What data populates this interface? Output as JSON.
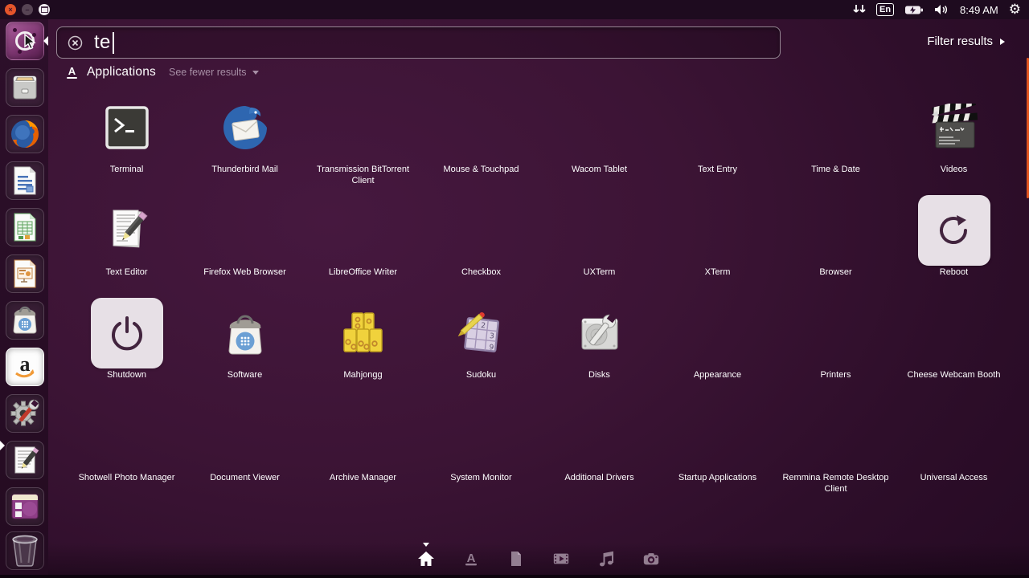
{
  "topbar": {
    "time": "8:49 AM",
    "keyboard_layout": "En",
    "window_controls": [
      "close",
      "minimize",
      "maximize"
    ],
    "tray_icons": [
      "network-transfer-arrows-icon",
      "keyboard-layout-indicator",
      "battery-charging-icon",
      "volume-icon",
      "clock",
      "session-gear-icon"
    ]
  },
  "search": {
    "query": "te",
    "clear_icon": "circle-x-icon",
    "filter_label": "Filter results"
  },
  "category_header": {
    "lens_icon": "applications-lens-icon",
    "label": "Applications",
    "toggle_label": "See fewer results"
  },
  "apps": [
    {
      "label": "Terminal",
      "icon": "terminal-icon"
    },
    {
      "label": "Thunderbird Mail",
      "icon": "thunderbird-icon"
    },
    {
      "label": "Transmission BitTorrent Client",
      "icon": null
    },
    {
      "label": "Mouse & Touchpad",
      "icon": null
    },
    {
      "label": "Wacom Tablet",
      "icon": null
    },
    {
      "label": "Text Entry",
      "icon": null
    },
    {
      "label": "Time & Date",
      "icon": null
    },
    {
      "label": "Videos",
      "icon": "clapperboard-icon"
    },
    {
      "label": "Text Editor",
      "icon": "text-editor-icon"
    },
    {
      "label": "Firefox Web Browser",
      "icon": null
    },
    {
      "label": "LibreOffice Writer",
      "icon": null
    },
    {
      "label": "Checkbox",
      "icon": null
    },
    {
      "label": "UXTerm",
      "icon": null
    },
    {
      "label": "XTerm",
      "icon": null
    },
    {
      "label": "Browser",
      "icon": null
    },
    {
      "label": "Reboot",
      "icon": "reboot-arrow-icon",
      "highlighted": true
    },
    {
      "label": "Shutdown",
      "icon": "power-icon",
      "highlighted": true
    },
    {
      "label": "Software",
      "icon": "software-bag-icon"
    },
    {
      "label": "Mahjongg",
      "icon": "mahjongg-tiles-icon"
    },
    {
      "label": "Sudoku",
      "icon": "sudoku-grid-icon"
    },
    {
      "label": "Disks",
      "icon": "disk-wrench-icon"
    },
    {
      "label": "Appearance",
      "icon": null
    },
    {
      "label": "Printers",
      "icon": null
    },
    {
      "label": "Cheese Webcam Booth",
      "icon": null
    },
    {
      "label": "Shotwell Photo Manager",
      "icon": null
    },
    {
      "label": "Document Viewer",
      "icon": null
    },
    {
      "label": "Archive Manager",
      "icon": null
    },
    {
      "label": "System Monitor",
      "icon": null
    },
    {
      "label": "Additional Drivers",
      "icon": null
    },
    {
      "label": "Startup Applications",
      "icon": null
    },
    {
      "label": "Remmina Remote Desktop Client",
      "icon": null
    },
    {
      "label": "Universal Access",
      "icon": null
    }
  ],
  "launcher": {
    "items": [
      {
        "name": "dash-home-button",
        "focused": true
      },
      {
        "name": "files-icon"
      },
      {
        "name": "firefox-icon"
      },
      {
        "name": "libreoffice-writer-icon"
      },
      {
        "name": "libreoffice-calc-icon"
      },
      {
        "name": "libreoffice-impress-icon"
      },
      {
        "name": "ubuntu-software-icon"
      },
      {
        "name": "amazon-icon"
      },
      {
        "name": "system-settings-icon"
      },
      {
        "name": "text-editor-icon",
        "running": true
      },
      {
        "name": "terminal-window-icon"
      },
      {
        "name": "trash-icon"
      }
    ]
  },
  "lens_bar": {
    "items": [
      {
        "name": "home-lens",
        "active": true
      },
      {
        "name": "applications-lens"
      },
      {
        "name": "files-lens"
      },
      {
        "name": "videos-lens"
      },
      {
        "name": "music-lens"
      },
      {
        "name": "photos-lens"
      }
    ]
  },
  "colors": {
    "accent_orange": "#E95420",
    "highlight_tile": "#E7E0E6",
    "scrollbar_orange": "#E0551F",
    "dash_background": "#3C1435",
    "panel_background": "#1E0B1F"
  }
}
